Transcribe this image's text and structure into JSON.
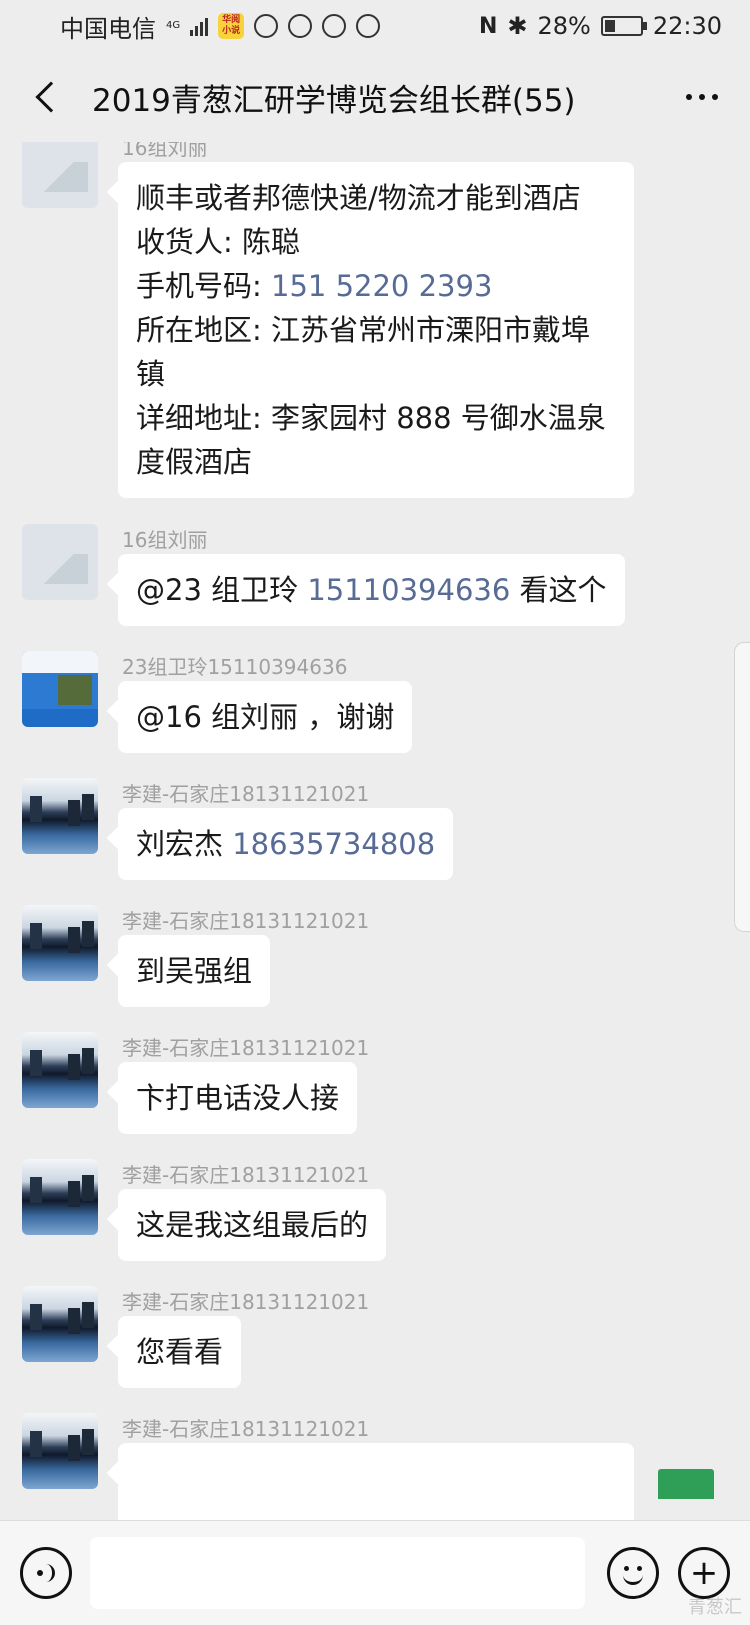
{
  "status_bar": {
    "carrier": "中国电信",
    "network": "4G",
    "app_badge": "华阅小说",
    "battery": "28%",
    "battery_level": 0.28,
    "time": "22:30"
  },
  "header": {
    "title": "2019青葱汇研学博览会组长群(55)"
  },
  "messages": [
    {
      "sender": "16组刘丽",
      "lines": [
        "顺丰或者邦德快递/物流才能到酒店",
        "收货人: 陈聪",
        "手机号码: ",
        "所在地区: 江苏省常州市溧阳市戴埠",
        "镇",
        "详细地址: 李家园村 888 号御水温泉",
        "度假酒店"
      ],
      "phone": "151 5220 2393"
    },
    {
      "sender": "16组刘丽",
      "text_before": "@23 组卫玲 ",
      "phone": "15110394636",
      "text_after": "  看这个"
    },
    {
      "sender": "23组卫玲15110394636",
      "text": "@16 组刘丽  ，谢谢"
    },
    {
      "sender": "李建-石家庄18131121021",
      "text_before": "刘宏杰   ",
      "phone": "18635734808"
    },
    {
      "sender": "李建-石家庄18131121021",
      "text": "到吴强组"
    },
    {
      "sender": "李建-石家庄18131121021",
      "text": "卞打电话没人接"
    },
    {
      "sender": "李建-石家庄18131121021",
      "text": "这是我这组最后的"
    },
    {
      "sender": "李建-石家庄18131121021",
      "text": "您看看"
    },
    {
      "sender": "李建-石家庄18131121021"
    }
  ],
  "icons": {
    "back": "chevron-left-icon",
    "more": "more-dots-icon",
    "voice": "voice-icon",
    "emoji": "emoji-icon",
    "plus": "plus-icon"
  },
  "input_bar": {
    "plus_symbol": "+"
  },
  "watermark": "青葱汇",
  "colors": {
    "background": "#ededed",
    "bubble": "#ffffff",
    "link_number": "#576b95",
    "sender_name": "#a0a0a0"
  }
}
